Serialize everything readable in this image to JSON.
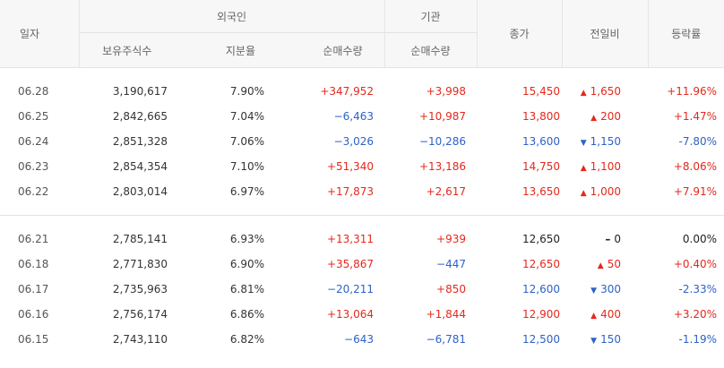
{
  "header": {
    "date": "일자",
    "foreign": "외국인",
    "institution": "기관",
    "close": "종가",
    "change": "전일비",
    "rate": "등락률",
    "holdings": "보유주식수",
    "share": "지분율",
    "foreign_net": "순매수량",
    "inst_net": "순매수량"
  },
  "rows": [
    {
      "date": "06.28",
      "holdings": "3,190,617",
      "share": "7.90%",
      "foreign_net": "+347,952",
      "foreign_dir": "up",
      "inst_net": "+3,998",
      "inst_dir": "up",
      "close": "15,450",
      "close_dir": "up",
      "change": "1,650",
      "change_dir": "up",
      "rate": "+11.96%",
      "rate_dir": "up"
    },
    {
      "date": "06.25",
      "holdings": "2,842,665",
      "share": "7.04%",
      "foreign_net": "−6,463",
      "foreign_dir": "down",
      "inst_net": "+10,987",
      "inst_dir": "up",
      "close": "13,800",
      "close_dir": "up",
      "change": "200",
      "change_dir": "up",
      "rate": "+1.47%",
      "rate_dir": "up"
    },
    {
      "date": "06.24",
      "holdings": "2,851,328",
      "share": "7.06%",
      "foreign_net": "−3,026",
      "foreign_dir": "down",
      "inst_net": "−10,286",
      "inst_dir": "down",
      "close": "13,600",
      "close_dir": "down",
      "change": "1,150",
      "change_dir": "down",
      "rate": "-7.80%",
      "rate_dir": "down"
    },
    {
      "date": "06.23",
      "holdings": "2,854,354",
      "share": "7.10%",
      "foreign_net": "+51,340",
      "foreign_dir": "up",
      "inst_net": "+13,186",
      "inst_dir": "up",
      "close": "14,750",
      "close_dir": "up",
      "change": "1,100",
      "change_dir": "up",
      "rate": "+8.06%",
      "rate_dir": "up"
    },
    {
      "date": "06.22",
      "holdings": "2,803,014",
      "share": "6.97%",
      "foreign_net": "+17,873",
      "foreign_dir": "up",
      "inst_net": "+2,617",
      "inst_dir": "up",
      "close": "13,650",
      "close_dir": "up",
      "change": "1,000",
      "change_dir": "up",
      "rate": "+7.91%",
      "rate_dir": "up"
    },
    {
      "date": "06.21",
      "holdings": "2,785,141",
      "share": "6.93%",
      "foreign_net": "+13,311",
      "foreign_dir": "up",
      "inst_net": "+939",
      "inst_dir": "up",
      "close": "12,650",
      "close_dir": "flat",
      "change": "0",
      "change_dir": "flat",
      "rate": "0.00%",
      "rate_dir": "flat"
    },
    {
      "date": "06.18",
      "holdings": "2,771,830",
      "share": "6.90%",
      "foreign_net": "+35,867",
      "foreign_dir": "up",
      "inst_net": "−447",
      "inst_dir": "down",
      "close": "12,650",
      "close_dir": "up",
      "change": "50",
      "change_dir": "up",
      "rate": "+0.40%",
      "rate_dir": "up"
    },
    {
      "date": "06.17",
      "holdings": "2,735,963",
      "share": "6.81%",
      "foreign_net": "−20,211",
      "foreign_dir": "down",
      "inst_net": "+850",
      "inst_dir": "up",
      "close": "12,600",
      "close_dir": "down",
      "change": "300",
      "change_dir": "down",
      "rate": "-2.33%",
      "rate_dir": "down"
    },
    {
      "date": "06.16",
      "holdings": "2,756,174",
      "share": "6.86%",
      "foreign_net": "+13,064",
      "foreign_dir": "up",
      "inst_net": "+1,844",
      "inst_dir": "up",
      "close": "12,900",
      "close_dir": "up",
      "change": "400",
      "change_dir": "up",
      "rate": "+3.20%",
      "rate_dir": "up"
    },
    {
      "date": "06.15",
      "holdings": "2,743,110",
      "share": "6.82%",
      "foreign_net": "−643",
      "foreign_dir": "down",
      "inst_net": "−6,781",
      "inst_dir": "down",
      "close": "12,500",
      "close_dir": "down",
      "change": "150",
      "change_dir": "down",
      "rate": "-1.19%",
      "rate_dir": "down"
    }
  ],
  "colors": {
    "up": "#e5281c",
    "down": "#2e62c5",
    "flat": "#222222"
  },
  "icons": {
    "up": "triangle-up-icon",
    "down": "triangle-down-icon",
    "flat": "dash-icon"
  }
}
